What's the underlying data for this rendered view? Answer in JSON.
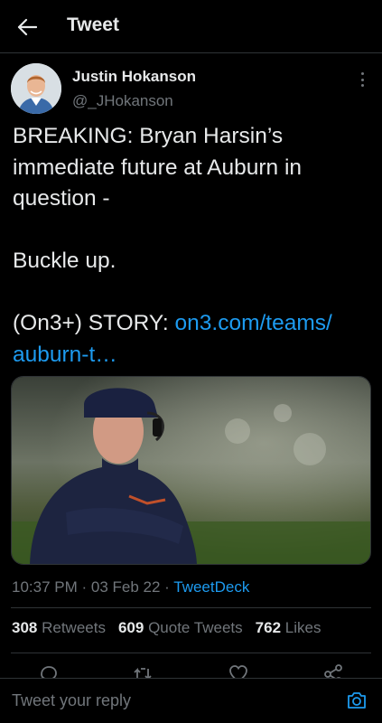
{
  "header": {
    "title": "Tweet",
    "back_icon": "arrow-left-icon"
  },
  "author": {
    "name": "Justin Hokanson",
    "handle": "@_JHokanson",
    "avatar_icon": "profile-avatar"
  },
  "tweet": {
    "lines": [
      "BREAKING: Bryan Harsin’s",
      "immediate future at Auburn in",
      "question -",
      "Buckle up.",
      "(On3+) STORY: "
    ],
    "link_part1": "on3.com/teams/",
    "link_part2": "auburn-t…",
    "media_alt": "Coach on sideline looking up"
  },
  "meta": {
    "time": "10:37 PM",
    "sep1": " · ",
    "date": "03 Feb 22",
    "sep2": " · ",
    "source": "TweetDeck"
  },
  "stats": {
    "retweets_count": "308",
    "retweets_label": " Retweets",
    "quotes_count": "609",
    "quotes_label": " Quote Tweets",
    "likes_count": "762",
    "likes_label": " Likes"
  },
  "reply": {
    "placeholder": "Tweet your reply"
  },
  "colors": {
    "background": "#000000",
    "text": "#e7e9ea",
    "muted": "#71767b",
    "link": "#1d9bf0",
    "divider": "#2f3336"
  }
}
